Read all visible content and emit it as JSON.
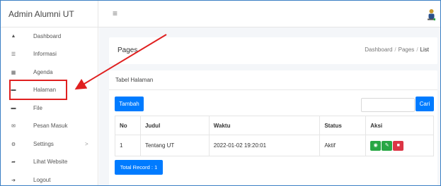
{
  "app": {
    "title": "Admin Alumni UT",
    "menu_icon": "hamburger-icon",
    "user_icon": "user-icon"
  },
  "sidebar": {
    "items": [
      {
        "label": "Dashboard",
        "icon": "home-icon"
      },
      {
        "label": "Informasi",
        "icon": "list-icon"
      },
      {
        "label": "Agenda",
        "icon": "calendar-icon"
      },
      {
        "label": "Halaman",
        "icon": "folder-icon"
      },
      {
        "label": "File",
        "icon": "folder-icon"
      },
      {
        "label": "Pesan Masuk",
        "icon": "envelope-icon"
      },
      {
        "label": "Settings",
        "icon": "gear-icon"
      },
      {
        "label": "Lihat Website",
        "icon": "share-icon"
      },
      {
        "label": "Logout",
        "icon": "sign-out-icon"
      }
    ],
    "settings_chevron": ">"
  },
  "header": {
    "page_title": "Pages",
    "breadcrumb": [
      "Dashboard",
      "Pages",
      "List"
    ],
    "sep": "/"
  },
  "card": {
    "title": "Tabel Halaman",
    "add_label": "Tambah",
    "search_label": "Cari",
    "search_value": "",
    "columns": [
      "No",
      "Judul",
      "Waktu",
      "Status",
      "Aksi"
    ],
    "rows": [
      {
        "no": "1",
        "judul": "Tentang UT",
        "waktu": "2022-01-02 19:20:01",
        "status": "Aktif"
      }
    ],
    "total_label": "Total Record : 1"
  },
  "colors": {
    "primary": "#007bff",
    "success": "#28a745",
    "danger": "#dc3545",
    "annotation": "#e02020"
  }
}
